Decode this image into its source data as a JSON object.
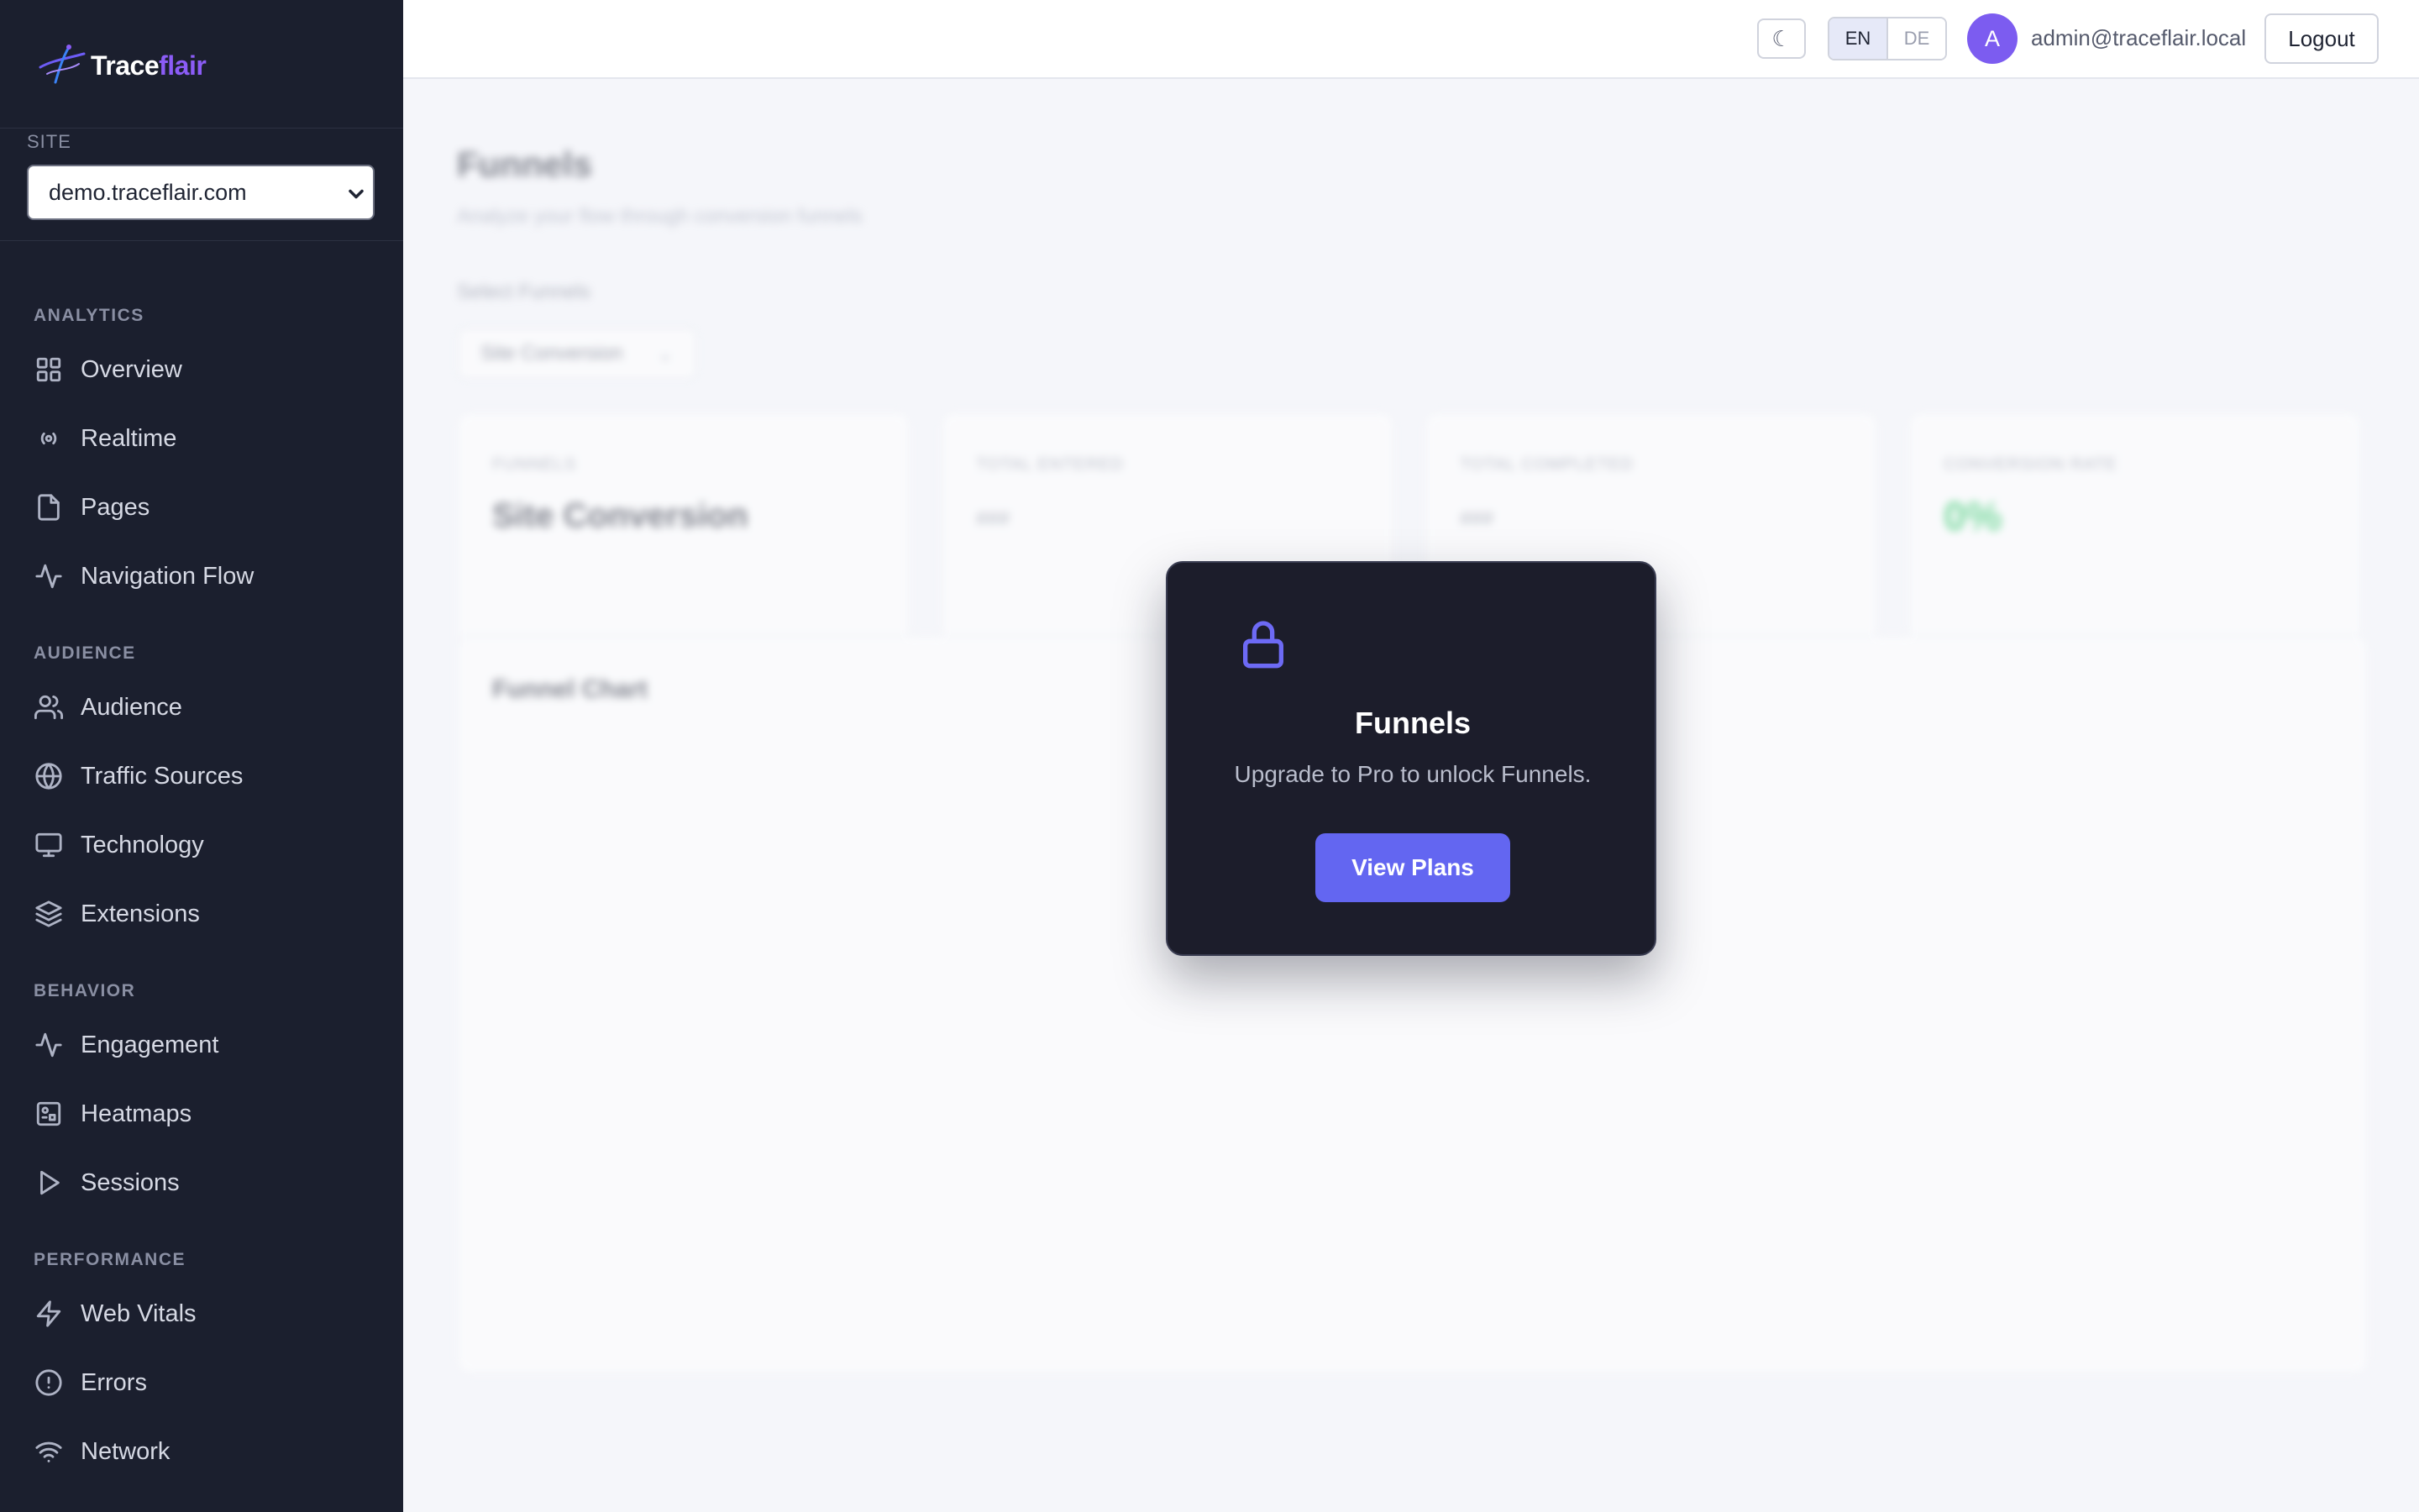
{
  "app": {
    "brand_main": "Trace",
    "brand_accent": "flair",
    "accent_color": "#8b5cf6",
    "primary_color": "#6366f1",
    "sidebar_bg": "#1b1f2e"
  },
  "sidebar": {
    "site_label": "SITE",
    "site_selected": "demo.traceflair.com",
    "sections": [
      {
        "label": "ANALYTICS",
        "items": [
          {
            "label": "Overview",
            "icon": "grid-icon"
          },
          {
            "label": "Realtime",
            "icon": "broadcast-icon"
          },
          {
            "label": "Pages",
            "icon": "file-icon"
          },
          {
            "label": "Navigation Flow",
            "icon": "activity-icon"
          }
        ]
      },
      {
        "label": "AUDIENCE",
        "items": [
          {
            "label": "Audience",
            "icon": "users-icon"
          },
          {
            "label": "Traffic Sources",
            "icon": "globe-icon"
          },
          {
            "label": "Technology",
            "icon": "monitor-icon"
          },
          {
            "label": "Extensions",
            "icon": "layers-icon"
          }
        ]
      },
      {
        "label": "BEHAVIOR",
        "items": [
          {
            "label": "Engagement",
            "icon": "activity-icon"
          },
          {
            "label": "Heatmaps",
            "icon": "heatmap-icon"
          },
          {
            "label": "Sessions",
            "icon": "play-icon"
          }
        ]
      },
      {
        "label": "PERFORMANCE",
        "items": [
          {
            "label": "Web Vitals",
            "icon": "zap-icon"
          },
          {
            "label": "Errors",
            "icon": "alert-circle-icon"
          },
          {
            "label": "Network",
            "icon": "wifi-icon"
          }
        ]
      }
    ]
  },
  "topbar": {
    "theme_glyph": "☾",
    "lang_en": "EN",
    "lang_de": "DE",
    "avatar_letter": "A",
    "user_email": "admin@traceflair.local",
    "logout_label": "Logout"
  },
  "main": {
    "title": "Funnels",
    "subtitle": "Analyze your flow through conversion funnels",
    "select_label": "Select Funnels",
    "select_value": "Site Conversion",
    "stats": [
      {
        "key": "FUNNELS",
        "value": "Site Conversion"
      },
      {
        "key": "TOTAL ENTERED",
        "value": "###"
      },
      {
        "key": "TOTAL COMPLETED",
        "value": "###"
      },
      {
        "key": "CONVERSION RATE",
        "value": "0%"
      }
    ],
    "chart_title": "Funnel Chart"
  },
  "modal": {
    "icon": "lock-icon",
    "title": "Funnels",
    "text": "Upgrade to Pro to unlock Funnels.",
    "button": "View Plans"
  }
}
